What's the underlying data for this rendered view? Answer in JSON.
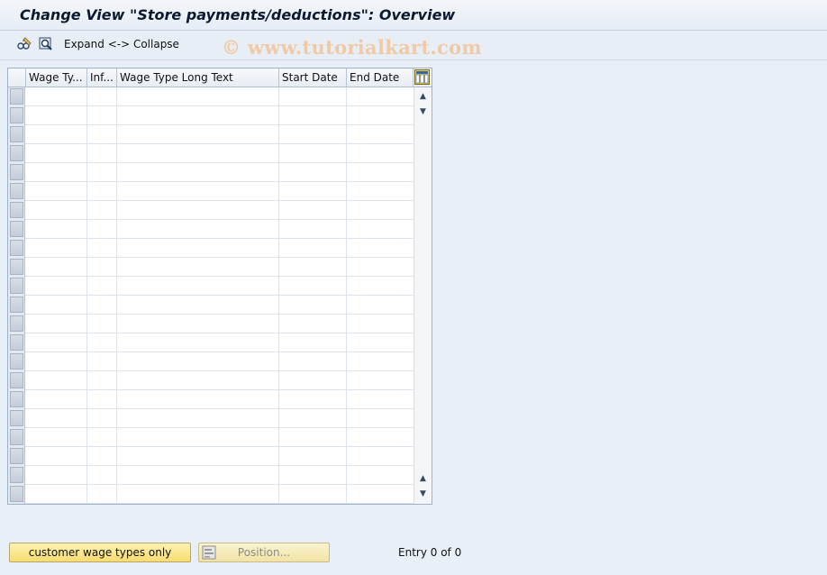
{
  "window": {
    "title": "Change View \"Store payments/deductions\": Overview"
  },
  "toolbar": {
    "expand_collapse_label": "Expand <-> Collapse",
    "icons": [
      "glasses-pencil-icon",
      "select-details-icon"
    ]
  },
  "watermark": "© www.tutorialkart.com",
  "table": {
    "columns": [
      {
        "key": "wage_type",
        "label": "Wage Ty..."
      },
      {
        "key": "infotype",
        "label": "Inf..."
      },
      {
        "key": "long_text",
        "label": "Wage Type Long Text"
      },
      {
        "key": "start_date",
        "label": "Start Date"
      },
      {
        "key": "end_date",
        "label": "End Date"
      }
    ],
    "rows": [],
    "visible_empty_rows": 22,
    "settings_icon": "table-settings-icon",
    "scroll_icons": [
      "scroll-up-icon",
      "scroll-down-icon",
      "scroll-page-up-icon",
      "scroll-page-down-icon"
    ]
  },
  "footer": {
    "customer_button_label": "customer wage types only",
    "position_button_label": "Position...",
    "entry_status": "Entry 0 of 0"
  },
  "colors": {
    "background": "#e9eff6",
    "button_primary": "#f7dc6e",
    "watermark": "#f0c9a6"
  }
}
